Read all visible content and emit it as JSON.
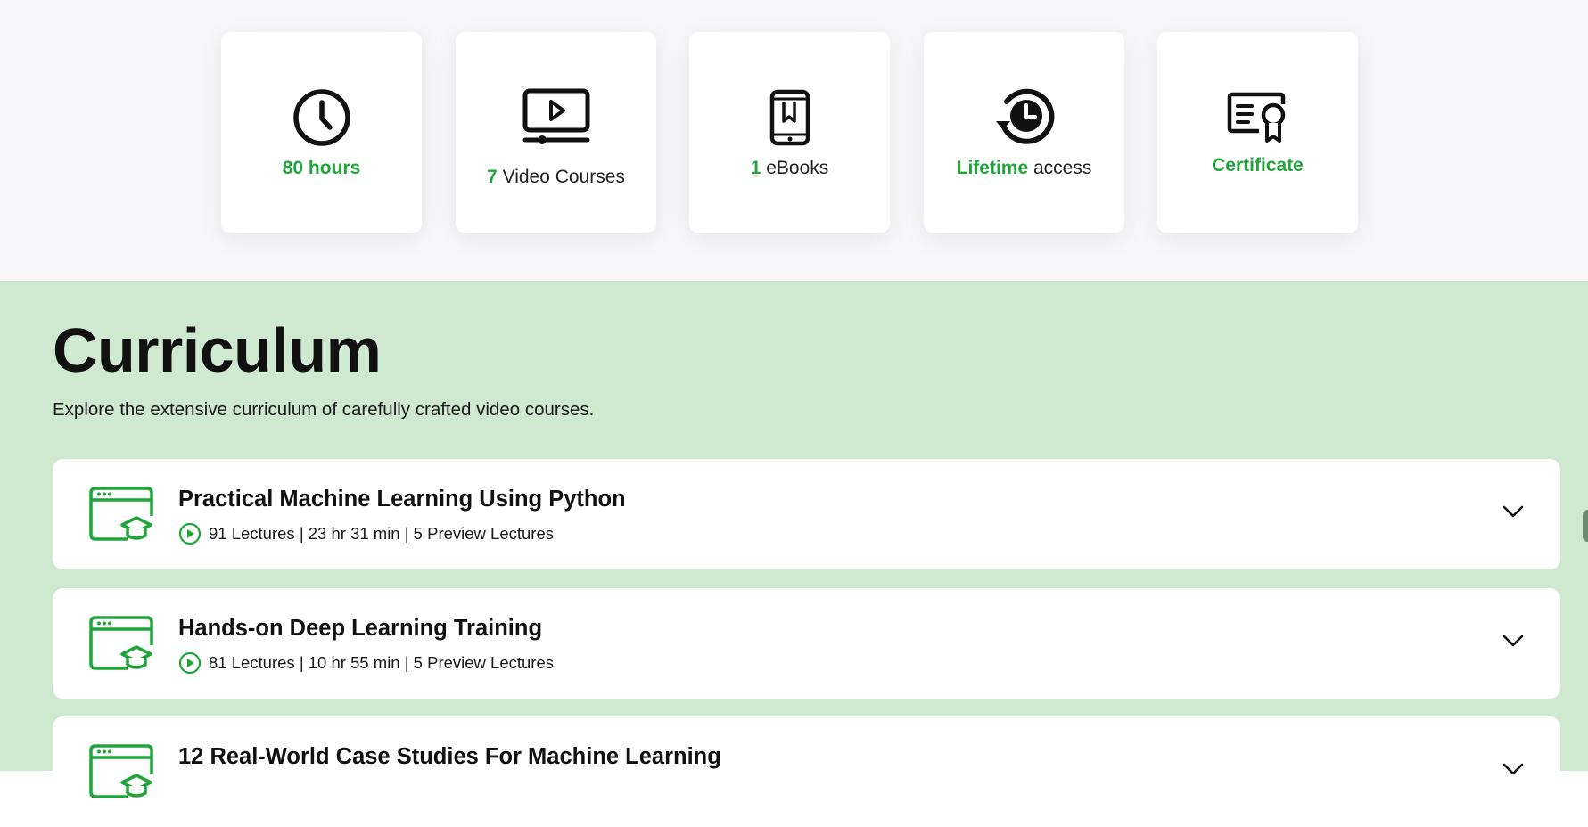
{
  "features": [
    {
      "icon": "clock-icon",
      "highlight": "80 hours",
      "text": ""
    },
    {
      "icon": "video-player-icon",
      "highlight": "7",
      "text": "Video Courses"
    },
    {
      "icon": "tablet-bookmark-icon",
      "highlight": "1",
      "text": "eBooks"
    },
    {
      "icon": "lifetime-history-icon",
      "highlight": "Lifetime",
      "text": "access"
    },
    {
      "icon": "certificate-icon",
      "highlight": "Certificate",
      "text": ""
    }
  ],
  "curriculum": {
    "title": "Curriculum",
    "subtitle": "Explore the extensive curriculum of carefully crafted video courses.",
    "courses": [
      {
        "title": "Practical Machine Learning Using Python",
        "meta": "91 Lectures | 23 hr 31 min | 5 Preview Lectures"
      },
      {
        "title": "Hands-on Deep Learning Training",
        "meta": "81 Lectures | 10 hr 55 min | 5 Preview Lectures"
      },
      {
        "title": "12 Real-World Case Studies For Machine Learning",
        "meta": ""
      }
    ]
  },
  "colors": {
    "accent": "#1fa53a",
    "section_bg": "#cfe8d0",
    "top_bg": "#f7f7f9"
  }
}
